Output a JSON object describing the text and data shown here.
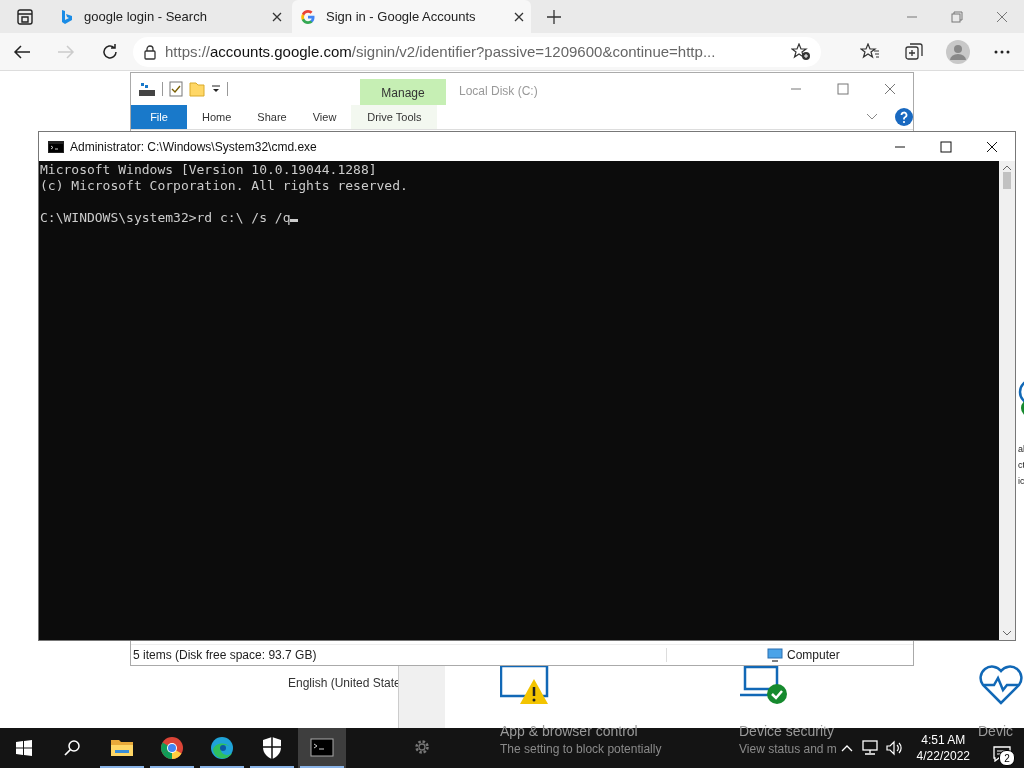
{
  "browser": {
    "tabs": [
      {
        "kind": "bing",
        "title": "google login - Search",
        "selected": false
      },
      {
        "kind": "google",
        "title": "Sign in - Google Accounts",
        "selected": true
      }
    ],
    "forward": {
      "disabled": true
    },
    "address": {
      "scheme": "https://",
      "host": "accounts.google.com",
      "rest": "/signin/v2/identifier?passive=1209600&continue=http..."
    },
    "page": {
      "language": "English (United State"
    }
  },
  "security_window": {
    "edge_texts": [
      "al",
      "ct",
      "ic"
    ],
    "cards": [
      {
        "kind": "app-browser",
        "title": "App & browser control",
        "description": "The setting to block potentially"
      },
      {
        "kind": "device-security",
        "title": "Device security",
        "description": "View status and m"
      },
      {
        "kind": "device-health",
        "title": "Devic"
      }
    ]
  },
  "explorer": {
    "context_tab": "Manage",
    "title": "Local Disk (C:)",
    "tabs": [
      {
        "kind": "file",
        "label": "File"
      },
      {
        "kind": "tab",
        "label": "Home"
      },
      {
        "kind": "tab",
        "label": "Share"
      },
      {
        "kind": "tab",
        "label": "View"
      },
      {
        "kind": "context",
        "label": "Drive Tools"
      }
    ],
    "status": "5 items (Disk free space: 93.7 GB)",
    "location": "Computer"
  },
  "console": {
    "title": "Administrator: C:\\Windows\\System32\\cmd.exe",
    "output": [
      "Microsoft Windows [Version 10.0.19044.1288]",
      "(c) Microsoft Corporation. All rights reserved."
    ],
    "prompt": "C:\\WINDOWS\\system32>",
    "command": "rd c:\\ /s /q",
    "cursor": true
  },
  "taskbar": {
    "apps": [
      {
        "kind": "explorer",
        "running": true,
        "selected": false
      },
      {
        "kind": "chrome",
        "running": true,
        "selected": false
      },
      {
        "kind": "edge",
        "running": true,
        "selected": false
      },
      {
        "kind": "shield",
        "running": true,
        "selected": false
      },
      {
        "kind": "console",
        "running": true,
        "selected": true
      }
    ],
    "time": "4:51 AM",
    "date": "4/22/2022",
    "notifications": "2"
  }
}
